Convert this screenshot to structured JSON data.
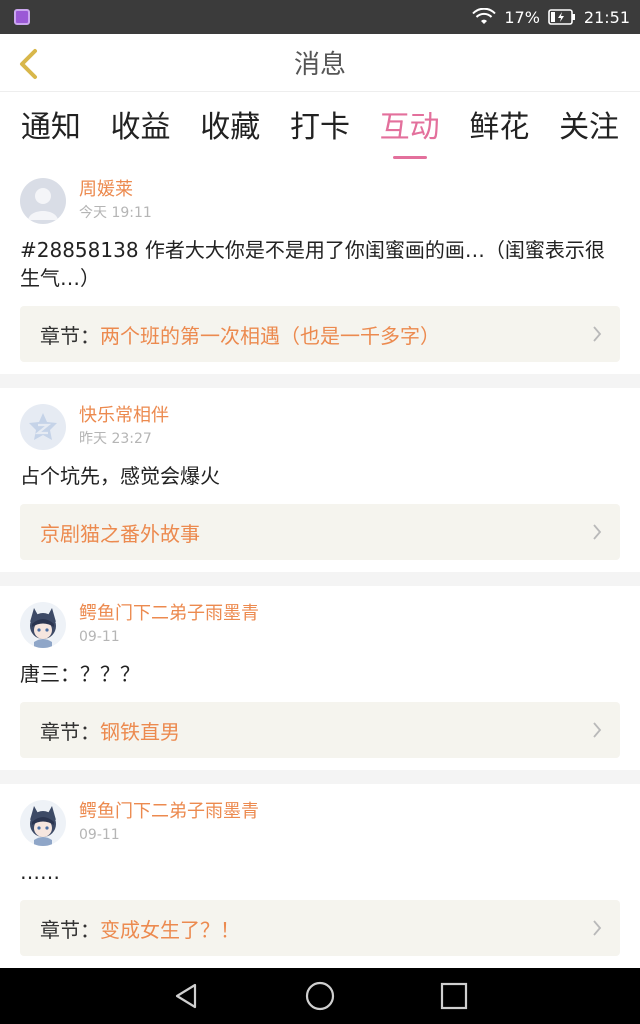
{
  "status_bar": {
    "battery_percent": "17%",
    "time": "21:51"
  },
  "header": {
    "title": "消息"
  },
  "tabs": [
    {
      "label": "通知"
    },
    {
      "label": "收益"
    },
    {
      "label": "收藏"
    },
    {
      "label": "打卡"
    },
    {
      "label": "互动",
      "active": true
    },
    {
      "label": "鲜花"
    },
    {
      "label": "关注"
    }
  ],
  "messages": [
    {
      "username": "周媛莱",
      "time": "今天 19:11",
      "text": "#28858138 作者大大你是不是用了你闺蜜画的画…（闺蜜表示很生气…）",
      "chapter_prefix": "章节：",
      "chapter_title": "两个班的第一次相遇（也是一千多字）"
    },
    {
      "username": "快乐常相伴",
      "time": "昨天 23:27",
      "text": "占个坑先，感觉会爆火",
      "chapter_prefix": "",
      "chapter_title": "京剧猫之番外故事"
    },
    {
      "username": "鳄鱼门下二弟子雨墨青",
      "time": "09-11",
      "text": "唐三：？？？",
      "chapter_prefix": "章节：",
      "chapter_title": "钢铁直男"
    },
    {
      "username": "鳄鱼门下二弟子雨墨青",
      "time": "09-11",
      "text": "……",
      "chapter_prefix": "章节：",
      "chapter_title": "变成女生了？！"
    }
  ],
  "colors": {
    "accent_pink": "#e3709c",
    "username_orange": "#ec8a4f",
    "back_arrow": "#d8b74a"
  }
}
